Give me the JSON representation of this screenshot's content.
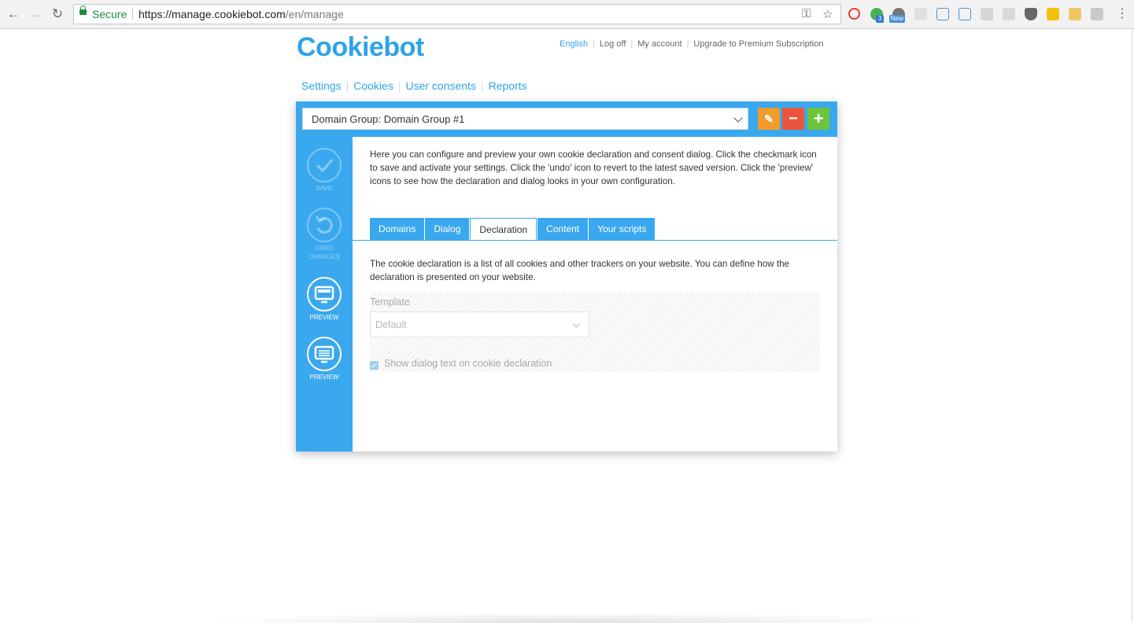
{
  "browser": {
    "secure_label": "Secure",
    "url_host": "https://manage.cookiebot.com",
    "url_path": "/en/manage",
    "ext_badge_count": "3",
    "ext_badge_new": "New"
  },
  "header": {
    "logo": "Cookiebot",
    "links": [
      "English",
      "Log off",
      "My account",
      "Upgrade to Premium Subscription"
    ]
  },
  "nav": {
    "items": [
      "Settings",
      "Cookies",
      "User consents",
      "Reports"
    ]
  },
  "panel": {
    "domain_group": "Domain Group: Domain Group #1",
    "sidebar": {
      "save": "SAVE",
      "undo_line1": "UNDO",
      "undo_line2": "CHANGES",
      "preview1": "PREVIEW",
      "preview2": "PREVIEW"
    },
    "intro": "Here you can configure and preview your own cookie declaration and consent dialog. Click the checkmark icon to save and activate your settings. Click the 'undo' icon to revert to the latest saved version. Click the 'preview' icons to see how the declaration and dialog looks in your own configuration.",
    "tabs": [
      "Domains",
      "Dialog",
      "Declaration",
      "Content",
      "Your scripts"
    ],
    "active_tab": "Declaration",
    "declaration_text": "The cookie declaration is a list of all cookies and other trackers on your website. You can define how the declaration is presented on your website.",
    "template_label": "Template",
    "template_value": "Default",
    "show_dialog_text_label": "Show dialog text on cookie declaration",
    "show_dialog_text_checked": true
  },
  "colors": {
    "brand_blue": "#3aa8ee",
    "edit_orange": "#f39a2c",
    "delete_red": "#e9553c",
    "add_green": "#6cc43a"
  }
}
